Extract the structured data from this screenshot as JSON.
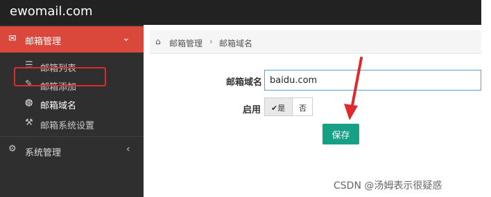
{
  "header": {
    "brand": "ewomail.com"
  },
  "sidebar": {
    "menu_mail": {
      "label": "邮箱管理",
      "icon": "envelope-icon",
      "chevron": "⌄"
    },
    "items": [
      {
        "label": "邮箱列表",
        "icon": "list-icon"
      },
      {
        "label": "邮箱添加",
        "icon": "pencil-icon"
      },
      {
        "label": "邮箱域名",
        "icon": "globe-icon"
      },
      {
        "label": "邮箱系统设置",
        "icon": "wrench-icon"
      }
    ],
    "menu_system": {
      "label": "系统管理",
      "icon": "gear-icon",
      "chevron": "‹"
    }
  },
  "breadcrumb": {
    "home_icon": "home-icon",
    "item1": "邮箱管理",
    "separator": "›",
    "item2": "邮箱域名"
  },
  "form": {
    "domain_label": "邮箱域名",
    "domain_value": "baidu.com",
    "enable_label": "启用",
    "enable_yes": "✔是",
    "enable_no": "否",
    "save_label": "保存"
  },
  "watermark": "CSDN @汤姆表示很疑惑",
  "colors": {
    "accent": "#d9483b",
    "save": "#16a085",
    "annotation": "#e0292a"
  }
}
